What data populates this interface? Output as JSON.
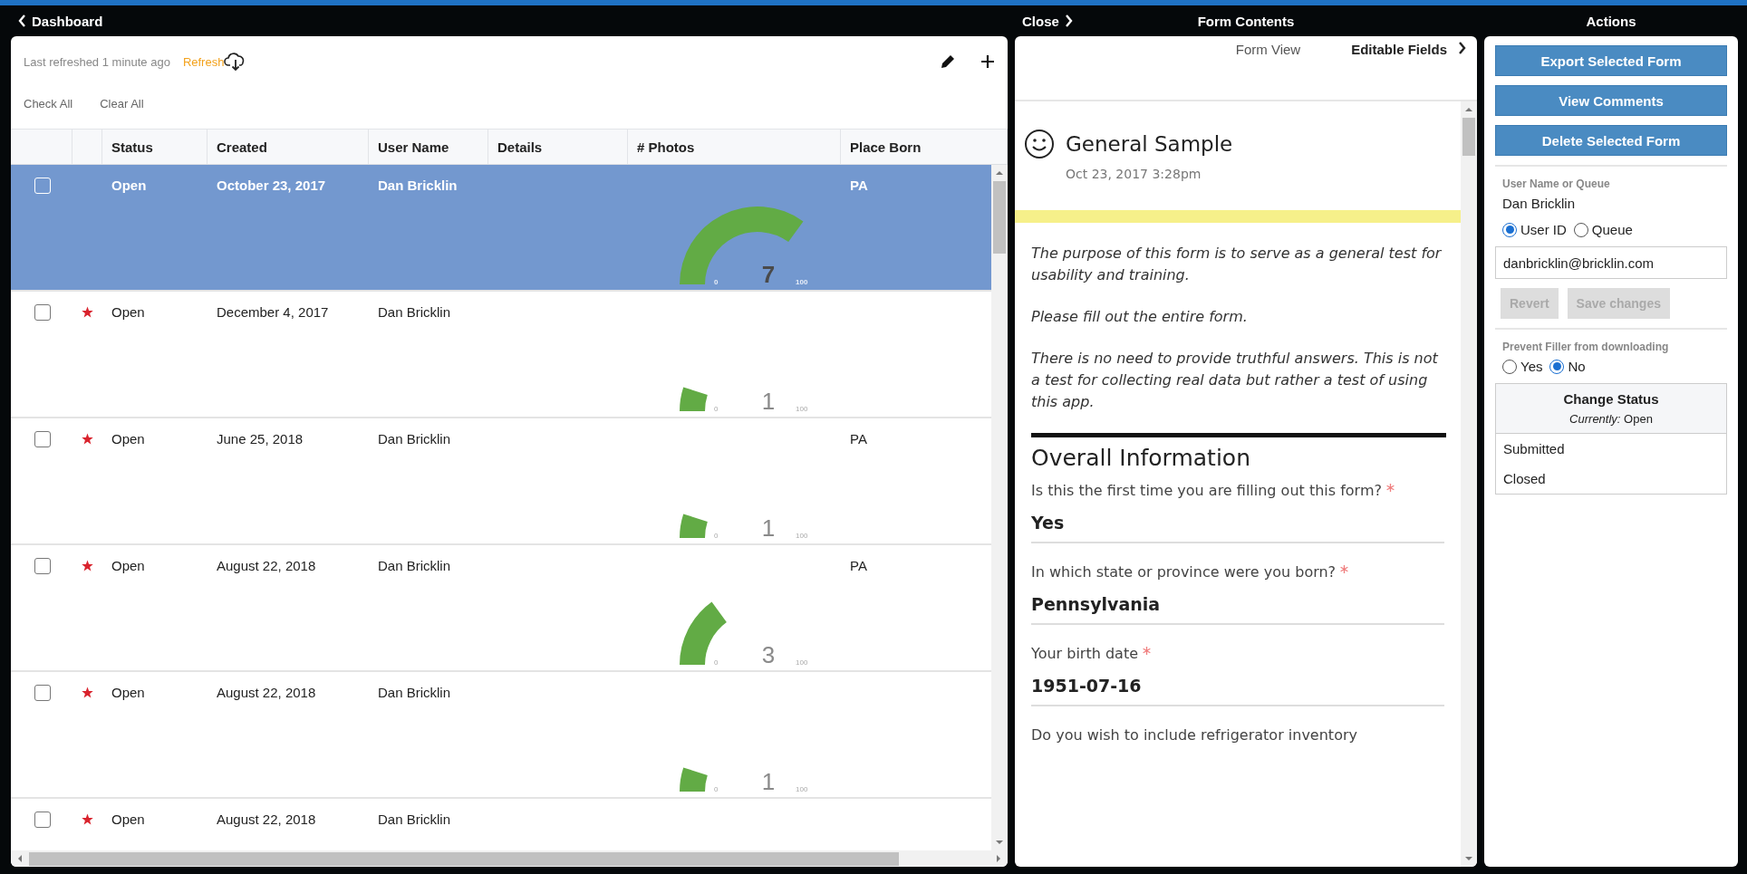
{
  "header": {
    "back_label": "Dashboard",
    "close_label": "Close",
    "middle_title": "Form Contents",
    "right_title": "Actions"
  },
  "toolbar": {
    "last_refreshed": "Last refreshed 1 minute ago",
    "refresh": "Refresh",
    "check_all": "Check All",
    "clear_all": "Clear All"
  },
  "table": {
    "columns": [
      "Status",
      "Created",
      "User Name",
      "Details",
      "# Photos",
      "Place Born"
    ],
    "rows": [
      {
        "selected": true,
        "checked": false,
        "starred": false,
        "status": "Open",
        "created": "October 23, 2017",
        "user_name": "Dan Bricklin",
        "place_born": "PA",
        "photos": {
          "level": 0.7,
          "value": "7",
          "min": "0",
          "max": "100"
        }
      },
      {
        "selected": false,
        "checked": false,
        "starred": true,
        "status": "Open",
        "created": "December 4, 2017",
        "user_name": "Dan Bricklin",
        "photos": {
          "level": 0.1,
          "value": "1",
          "min": "0",
          "max": "100"
        }
      },
      {
        "selected": false,
        "checked": false,
        "starred": true,
        "status": "Open",
        "created": "June 25, 2018",
        "user_name": "Dan Bricklin",
        "place_born": "PA",
        "photos": {
          "level": 0.1,
          "value": "1",
          "min": "0",
          "max": "100"
        }
      },
      {
        "selected": false,
        "checked": false,
        "starred": true,
        "status": "Open",
        "created": "August 22, 2018",
        "user_name": "Dan Bricklin",
        "place_born": "PA",
        "photos": {
          "level": 0.3,
          "value": "3",
          "min": "0",
          "max": "100"
        }
      },
      {
        "selected": false,
        "checked": false,
        "starred": true,
        "status": "Open",
        "created": "August 22, 2018",
        "user_name": "Dan Bricklin",
        "photos": {
          "level": 0.1,
          "value": "1",
          "min": "0",
          "max": "100"
        }
      },
      {
        "selected": false,
        "checked": false,
        "starred": true,
        "status": "Open",
        "created": "August 22, 2018",
        "user_name": "Dan Bricklin"
      }
    ]
  },
  "form": {
    "tabs": [
      {
        "label": "Form View",
        "selected": false
      },
      {
        "label": "Editable Fields",
        "selected": true
      }
    ],
    "title": "General Sample",
    "date": "Oct 23, 2017 3:28pm",
    "intro": [
      "The purpose of this form is to serve as a general test for usability and training.",
      "Please fill out the entire form.",
      "There is no need to provide truthful answers. This is not a test for collecting real data but rather a test of using this app."
    ],
    "section": "Overall Information",
    "questions": [
      {
        "label": "Is this the first time you are filling out this form?",
        "required": true,
        "answer": "Yes"
      },
      {
        "label": "In which state or province were you born?",
        "required": true,
        "answer": "Pennsylvania"
      },
      {
        "label": "Your birth date",
        "required": true,
        "answer": "1951-07-16"
      },
      {
        "label": "Do you wish to include refrigerator inventory"
      }
    ]
  },
  "actions": {
    "buttons": [
      "Export Selected Form",
      "View Comments",
      "Delete Selected Form"
    ],
    "user_label": "User Name or Queue",
    "user_name": "Dan Bricklin",
    "id_options": [
      {
        "label": "User ID",
        "selected": true
      },
      {
        "label": "Queue",
        "selected": false
      }
    ],
    "email": "danbricklin@bricklin.com",
    "edit_buttons": [
      {
        "label": "Revert",
        "disabled": true
      },
      {
        "label": "Save changes",
        "disabled": true
      }
    ],
    "prevent_label": "Prevent Filler from downloading",
    "prevent_options": [
      {
        "label": "Yes",
        "selected": false
      },
      {
        "label": "No",
        "selected": true
      }
    ],
    "status": {
      "title": "Change Status",
      "current": "*Currently:* Open",
      "options": [
        "Submitted",
        "Closed"
      ]
    }
  }
}
